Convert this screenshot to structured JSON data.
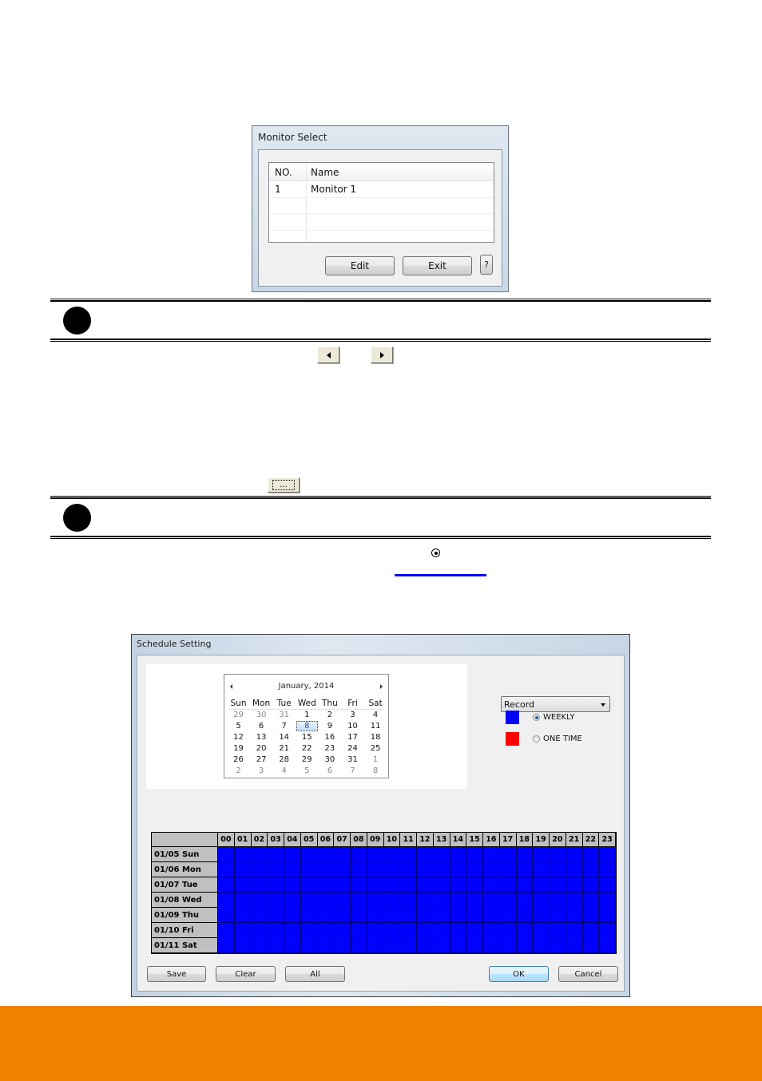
{
  "monitor_select": {
    "title": "Monitor Select",
    "columns": [
      "NO.",
      "Name"
    ],
    "rows": [
      {
        "no": "1",
        "name": "Monitor 1"
      }
    ],
    "buttons": {
      "edit": "Edit",
      "exit": "Exit",
      "help": "?"
    }
  },
  "inline_controls": {
    "prev_arrow": "previous-button",
    "next_arrow": "next-button",
    "browse_label": "...",
    "radio_symbol": "selected-radio"
  },
  "schedule_setting": {
    "title": "Schedule Setting",
    "calendar": {
      "month_label": "January, 2014",
      "weekdays": [
        "Sun",
        "Mon",
        "Tue",
        "Wed",
        "Thu",
        "Fri",
        "Sat"
      ],
      "weeks": [
        [
          {
            "d": "29",
            "dim": true
          },
          {
            "d": "30",
            "dim": true
          },
          {
            "d": "31",
            "dim": true
          },
          {
            "d": "1"
          },
          {
            "d": "2"
          },
          {
            "d": "3"
          },
          {
            "d": "4"
          }
        ],
        [
          {
            "d": "5"
          },
          {
            "d": "6"
          },
          {
            "d": "7"
          },
          {
            "d": "8",
            "selected": true
          },
          {
            "d": "9"
          },
          {
            "d": "10"
          },
          {
            "d": "11"
          }
        ],
        [
          {
            "d": "12"
          },
          {
            "d": "13"
          },
          {
            "d": "14"
          },
          {
            "d": "15"
          },
          {
            "d": "16"
          },
          {
            "d": "17"
          },
          {
            "d": "18"
          }
        ],
        [
          {
            "d": "19"
          },
          {
            "d": "20"
          },
          {
            "d": "21"
          },
          {
            "d": "22"
          },
          {
            "d": "23"
          },
          {
            "d": "24"
          },
          {
            "d": "25"
          }
        ],
        [
          {
            "d": "26"
          },
          {
            "d": "27"
          },
          {
            "d": "28"
          },
          {
            "d": "29"
          },
          {
            "d": "30"
          },
          {
            "d": "31"
          },
          {
            "d": "1",
            "dim": true
          }
        ],
        [
          {
            "d": "2",
            "dim": true
          },
          {
            "d": "3",
            "dim": true
          },
          {
            "d": "4",
            "dim": true
          },
          {
            "d": "5",
            "dim": true
          },
          {
            "d": "6",
            "dim": true
          },
          {
            "d": "7",
            "dim": true
          },
          {
            "d": "8",
            "dim": true
          }
        ]
      ]
    },
    "mode_select": {
      "value": "Record"
    },
    "schedule_types": [
      {
        "label": "WEEKLY",
        "color": "#0000ff",
        "selected": true
      },
      {
        "label": "ONE TIME",
        "color": "#ff0000",
        "selected": false
      }
    ],
    "grid": {
      "hours": [
        "00",
        "01",
        "02",
        "03",
        "04",
        "05",
        "06",
        "07",
        "08",
        "09",
        "10",
        "11",
        "12",
        "13",
        "14",
        "15",
        "16",
        "17",
        "18",
        "19",
        "20",
        "21",
        "22",
        "23"
      ],
      "days": [
        "01/05 Sun",
        "01/06 Mon",
        "01/07 Tue",
        "01/08 Wed",
        "01/09 Thu",
        "01/10 Fri",
        "01/11 Sat"
      ],
      "fill_color": "#0000ff",
      "all_slots_scheduled": true
    },
    "buttons": {
      "save": "Save",
      "clear": "Clear",
      "all": "All",
      "ok": "OK",
      "cancel": "Cancel"
    }
  },
  "colors": {
    "footer_orange": "#ef8200",
    "link_blue": "#0000ff"
  }
}
